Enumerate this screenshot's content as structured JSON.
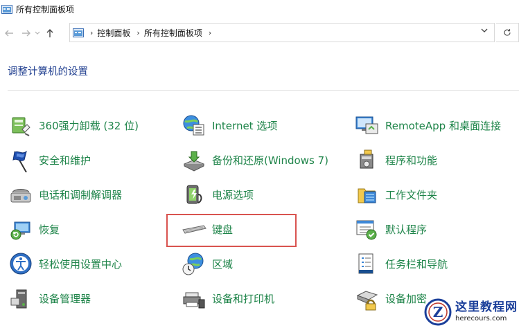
{
  "window": {
    "title": "所有控制面板项"
  },
  "address": {
    "crumbs": [
      "控制面板",
      "所有控制面板项"
    ]
  },
  "heading": "调整计算机的设置",
  "items": {
    "c1": [
      {
        "name": "360强力卸载 (32 位)",
        "icon": "uninstall-icon"
      },
      {
        "name": "安全和维护",
        "icon": "flag-icon"
      },
      {
        "name": "电话和调制解调器",
        "icon": "phone-modem-icon"
      },
      {
        "name": "恢复",
        "icon": "recovery-icon"
      },
      {
        "name": "轻松使用设置中心",
        "icon": "ease-of-access-icon"
      },
      {
        "name": "设备管理器",
        "icon": "device-manager-icon"
      }
    ],
    "c2": [
      {
        "name": "Internet 选项",
        "icon": "internet-options-icon"
      },
      {
        "name": "备份和还原(Windows 7)",
        "icon": "backup-icon"
      },
      {
        "name": "电源选项",
        "icon": "power-icon"
      },
      {
        "name": "键盘",
        "icon": "keyboard-icon"
      },
      {
        "name": "区域",
        "icon": "region-icon"
      },
      {
        "name": "设备和打印机",
        "icon": "printer-icon"
      }
    ],
    "c3": [
      {
        "name": "RemoteApp 和桌面连接",
        "icon": "remoteapp-icon"
      },
      {
        "name": "程序和功能",
        "icon": "programs-icon"
      },
      {
        "name": "工作文件夹",
        "icon": "work-folders-icon"
      },
      {
        "name": "默认程序",
        "icon": "default-programs-icon"
      },
      {
        "name": "任务栏和导航",
        "icon": "taskbar-icon"
      },
      {
        "name": "设备加密",
        "icon": "encryption-icon"
      }
    ]
  },
  "watermark": {
    "cn": "这里教程网",
    "en": "herecours.com",
    "letter": "Z"
  }
}
